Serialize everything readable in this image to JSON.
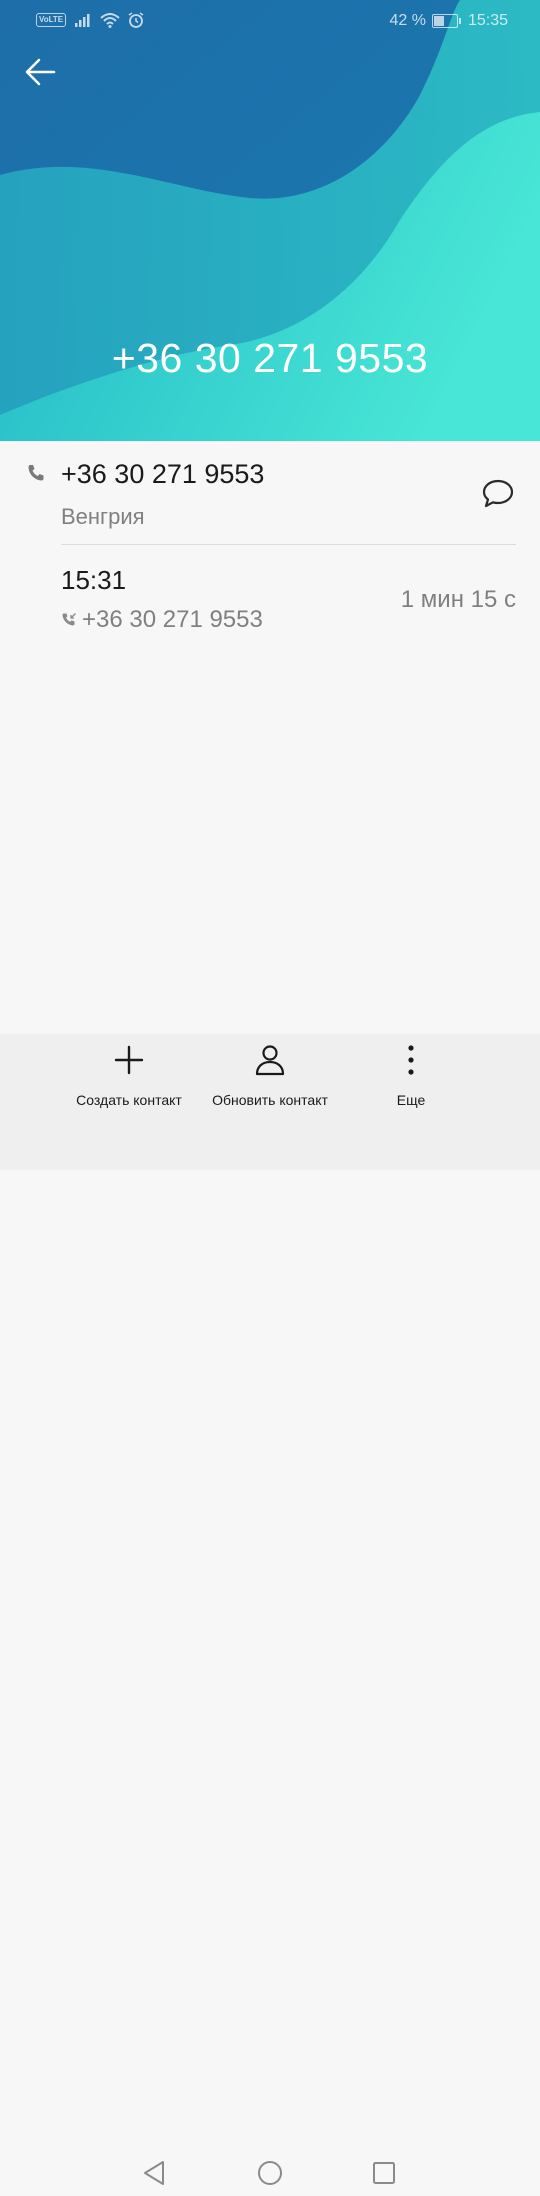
{
  "status_bar": {
    "network_badge": "VoLTE",
    "battery_percent": "42 %",
    "battery_level": 0.42,
    "time": "15:35",
    "icons": [
      "signal-icon",
      "wifi-icon",
      "alarm-icon",
      "battery-icon"
    ]
  },
  "header": {
    "phone_number": "+36 30 271 9553",
    "back_icon": "arrow-left-icon",
    "gradient_colors": [
      "#1a6fa8",
      "#2ab8c4",
      "#45e0d2"
    ]
  },
  "number_entry": {
    "number": "+36 30 271 9553",
    "country": "Венгрия",
    "icon": "phone-icon",
    "message_icon": "message-bubble-icon"
  },
  "call_log": [
    {
      "time": "15:31",
      "number": "+36 30 271 9553",
      "duration": "1 мин 15 с",
      "icon": "incoming-call-icon"
    }
  ],
  "bottom_actions": [
    {
      "label": "Создать контакт",
      "icon": "plus-icon"
    },
    {
      "label": "Обновить контакт",
      "icon": "person-icon"
    },
    {
      "label": "Еще",
      "icon": "more-vertical-icon"
    }
  ],
  "navigation": {
    "icons": [
      "nav-back-icon",
      "nav-home-icon",
      "nav-recents-icon"
    ]
  }
}
